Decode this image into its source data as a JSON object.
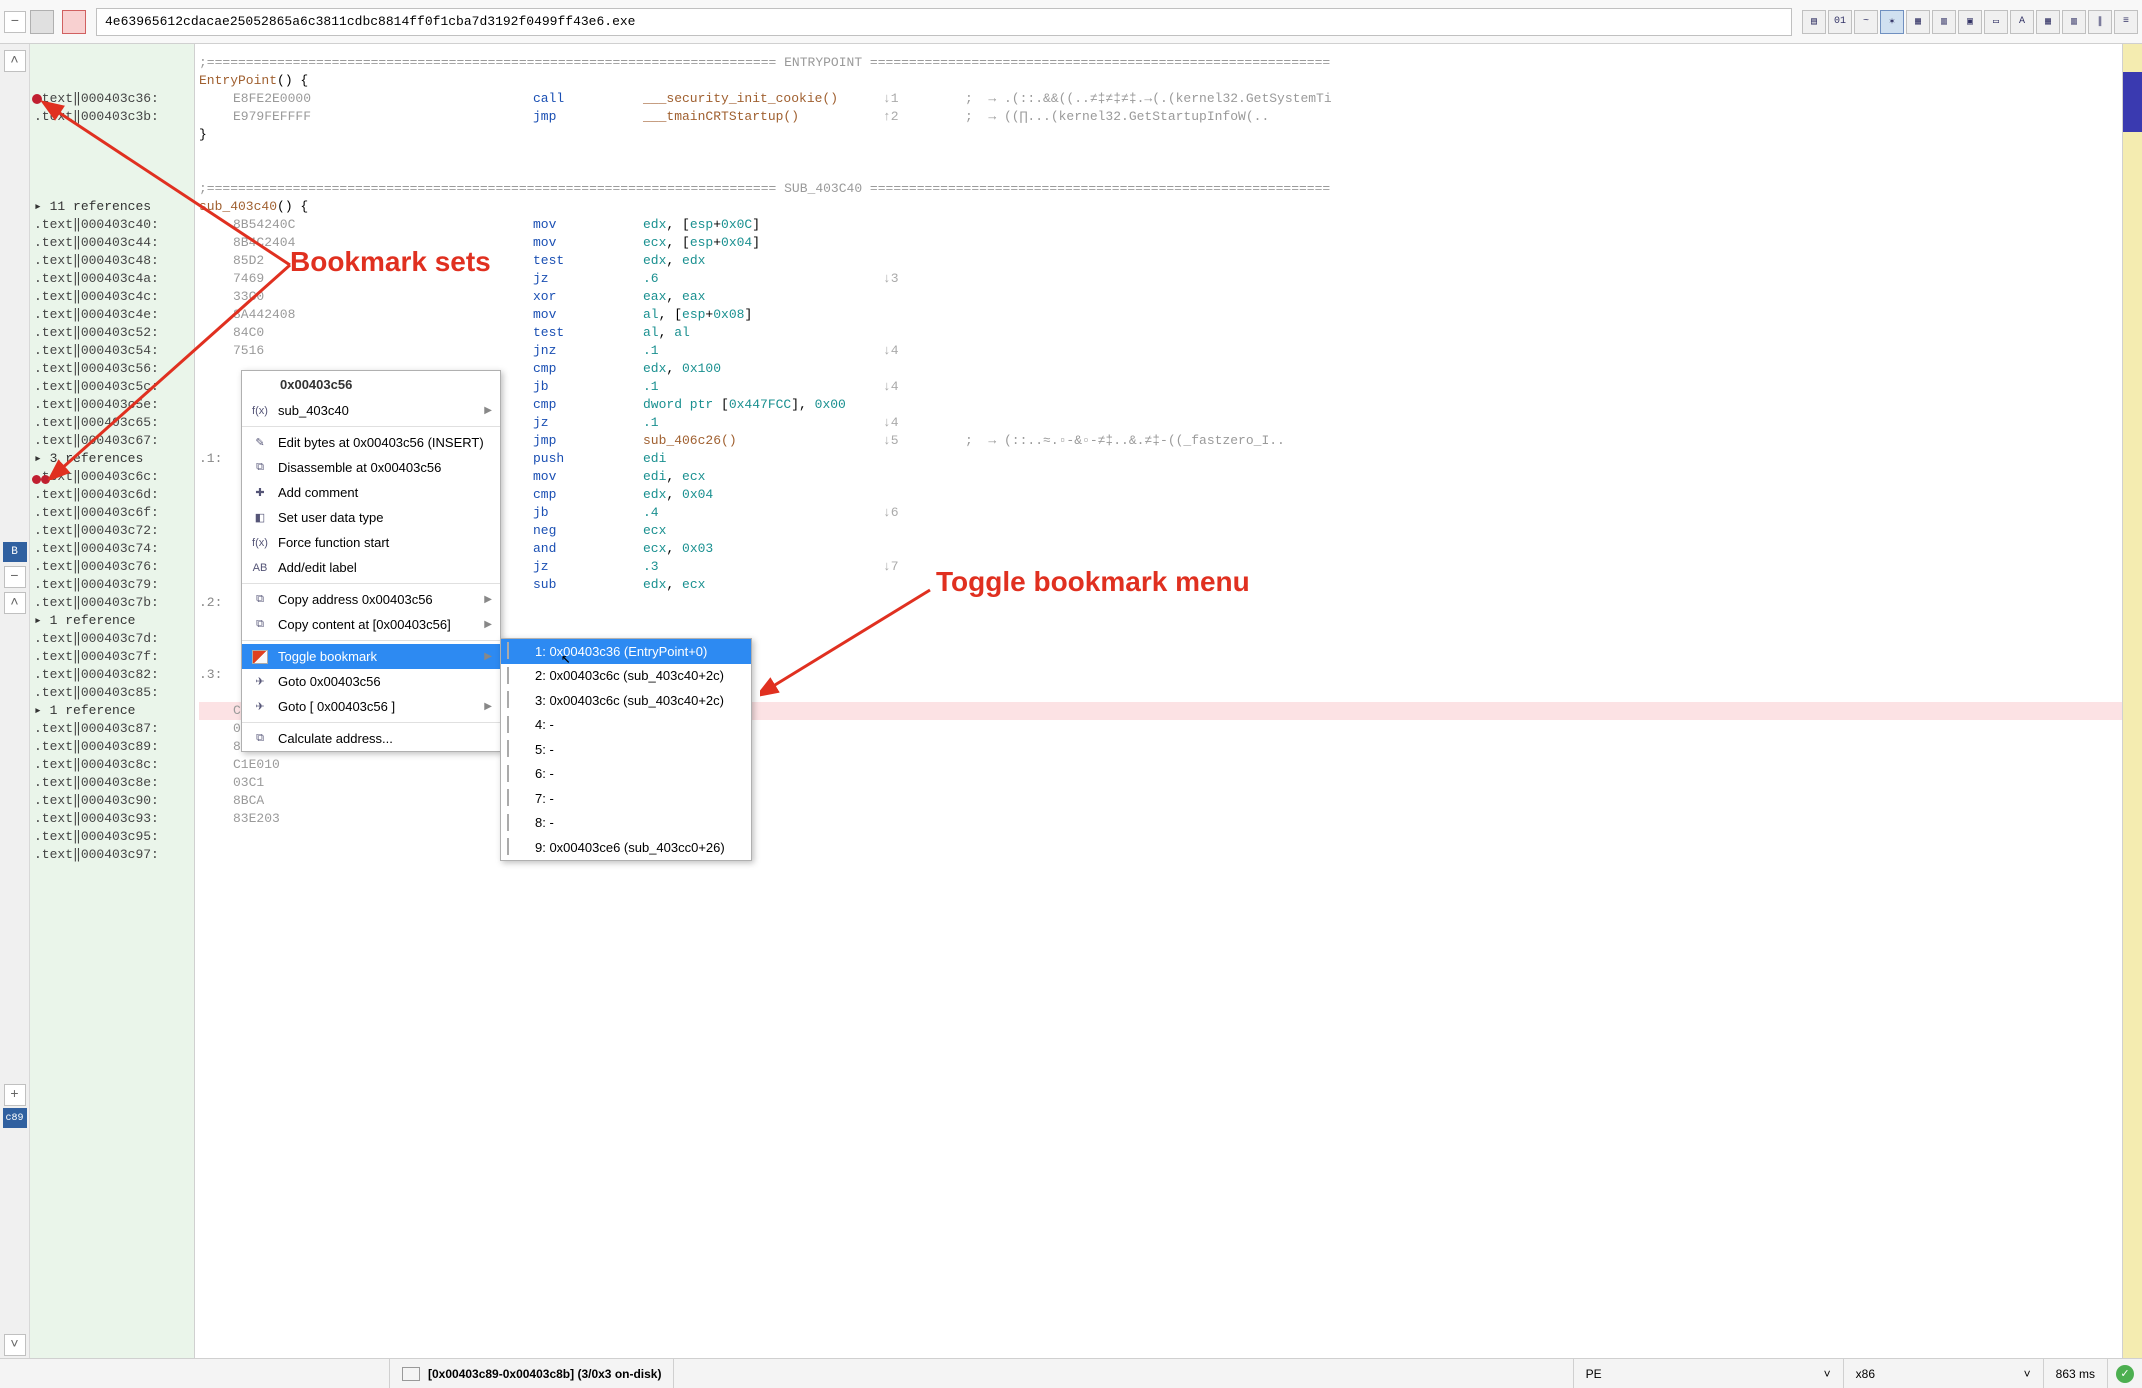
{
  "topbar": {
    "filename": "4e63965612cdacae25052865a6c3811cdbc8814ff0f1cba7d3192f0499ff43e6.exe"
  },
  "annotations": {
    "a1": "Bookmark sets",
    "a2": "Toggle bookmark menu"
  },
  "addr_lines": [
    {
      "t": ""
    },
    {
      "t": ""
    },
    {
      "t": "   .text‖000403c36:",
      "bk": 1
    },
    {
      "t": "   .text‖000403c3b:"
    },
    {
      "t": ""
    },
    {
      "t": ""
    },
    {
      "t": ""
    },
    {
      "t": ""
    },
    {
      "t": " ▸ 11 references",
      "ref": 1
    },
    {
      "t": "   .text‖000403c40:"
    },
    {
      "t": "   .text‖000403c44:"
    },
    {
      "t": "   .text‖000403c48:"
    },
    {
      "t": "   .text‖000403c4a:"
    },
    {
      "t": "   .text‖000403c4c:"
    },
    {
      "t": "   .text‖000403c4e:"
    },
    {
      "t": "   .text‖000403c52:"
    },
    {
      "t": "   .text‖000403c54:"
    },
    {
      "t": "   .text‖000403c56:"
    },
    {
      "t": "   .text‖000403c5c:"
    },
    {
      "t": "   .text‖000403c5e:"
    },
    {
      "t": "   .text‖000403c65:"
    },
    {
      "t": "   .text‖000403c67:"
    },
    {
      "t": " ▸ 3 references",
      "ref": 1
    },
    {
      "t": "   .text‖000403c6c:",
      "bk": 2
    },
    {
      "t": "   .text‖000403c6d:"
    },
    {
      "t": "   .text‖000403c6f:"
    },
    {
      "t": "   .text‖000403c72:"
    },
    {
      "t": "   .text‖000403c74:"
    },
    {
      "t": "   .text‖000403c76:"
    },
    {
      "t": "   .text‖000403c79:"
    },
    {
      "t": "   .text‖000403c7b:"
    },
    {
      "t": " ▸ 1 reference",
      "ref": 1
    },
    {
      "t": "   .text‖000403c7d:"
    },
    {
      "t": "   .text‖000403c7f:"
    },
    {
      "t": "   .text‖000403c82:"
    },
    {
      "t": "   .text‖000403c85:"
    },
    {
      "t": " ▸ 1 reference",
      "ref": 1
    },
    {
      "t": "   .text‖000403c87:"
    },
    {
      "t": "   .text‖000403c89:"
    },
    {
      "t": "   .text‖000403c8c:"
    },
    {
      "t": "   .text‖000403c8e:"
    },
    {
      "t": "   .text‖000403c90:"
    },
    {
      "t": "   .text‖000403c93:"
    },
    {
      "t": "   .text‖000403c95:"
    },
    {
      "t": "   .text‖000403c97:"
    }
  ],
  "code": {
    "sep1_l": ";========================================================================= ",
    "sep1_m": "ENTRYPOINT",
    "sep1_r": " ===========================================================",
    "entry_sig": "EntryPoint() {",
    "r1_hex": "E8FE2E0000",
    "r1_mn": "call",
    "r1_fn": "___security_init_cookie()",
    "r1_j": "↓1",
    "r1_c": ";  → .(::.&&((..≠‡≠‡≠‡.→(.(kernel32.GetSystemTi",
    "r2_hex": "E979FEFFFF",
    "r2_mn": "jmp",
    "r2_fn": "___tmainCRTStartup()",
    "r2_j": "↑2",
    "r2_c": ";  → ((∏...(kernel32.GetStartupInfoW(..",
    "close": "}",
    "sep2_l": ";========================================================================= ",
    "sep2_m": "SUB_403C40",
    "sep2_r": " ===========================================================",
    "sub_sig": "sub_403c40() {",
    "rows": [
      {
        "h": "8B54240C",
        "m": "mov",
        "o": "edx, [esp+0x0C]"
      },
      {
        "l": "",
        "h": "8B4C2404",
        "m": "mov",
        "o": "ecx, [esp+0x04]"
      },
      {
        "l": "",
        "h": "85D2",
        "m": "test",
        "o": "edx, edx"
      },
      {
        "l": "",
        "h": "7469",
        "m": "jz",
        "o": ".6",
        "j": "↓3"
      },
      {
        "l": "",
        "h": "33C0",
        "m": "xor",
        "o": "eax, eax"
      },
      {
        "l": "",
        "h": "8A442408",
        "m": "mov",
        "o": "al, [esp+0x08]"
      },
      {
        "l": "",
        "h": "84C0",
        "m": "test",
        "o": "al, al"
      },
      {
        "l": "",
        "h": "7516",
        "m": "jnz",
        "o": ".1",
        "j": "↓4"
      },
      {
        "l": "",
        "h": "",
        "m": "cmp",
        "o": "edx, 0x100"
      },
      {
        "l": "",
        "h": "",
        "m": "jb",
        "o": ".1",
        "j": "↓4"
      },
      {
        "l": "",
        "h": "",
        "m": "cmp",
        "o": "dword ptr [0x447FCC], 0x00"
      },
      {
        "l": "",
        "h": "",
        "m": "jz",
        "o": ".1",
        "j": "↓4"
      },
      {
        "l": "",
        "h": "",
        "m": "jmp",
        "o": "sub_406c26()",
        "j": "↓5",
        "c": ";  → (::..≈.▫-&▫-≠‡..&.≠‡-((_fastzero_I.."
      },
      {
        "l": ".1:",
        "h": "",
        "m": "push",
        "o": "edi"
      },
      {
        "l": "",
        "h": "",
        "m": "mov",
        "o": "edi, ecx"
      },
      {
        "l": "",
        "h": "",
        "m": "cmp",
        "o": "edx, 0x04"
      },
      {
        "l": "",
        "h": "",
        "m": "jb",
        "o": ".4",
        "j": "↓6"
      },
      {
        "l": "",
        "h": "",
        "m": "neg",
        "o": "ecx"
      },
      {
        "l": "",
        "h": "",
        "m": "and",
        "o": "ecx, 0x03"
      },
      {
        "l": "",
        "h": "",
        "m": "jz",
        "o": ".3",
        "j": "↓7"
      },
      {
        "l": "",
        "h": "",
        "m": "sub",
        "o": "edx, ecx"
      },
      {
        "l": ".2:",
        "h": "",
        "m": "",
        "o": ""
      },
      {
        "l": "",
        "h": "",
        "m": "",
        "o": ""
      },
      {
        "l": "",
        "h": "",
        "m": "",
        "o": ""
      },
      {
        "l": "",
        "h": "",
        "m": "",
        "o": ""
      },
      {
        "l": ".3:",
        "h": "",
        "m": "",
        "o": ""
      },
      {
        "l": "",
        "h": "",
        "m": "",
        "o": ""
      },
      {
        "l": "",
        "h": "C1E008",
        "m": "",
        "o": "",
        "hl": 1
      },
      {
        "l": "",
        "h": "03C1",
        "m": "",
        "o": ""
      },
      {
        "l": "",
        "h": "8BC8",
        "m": "",
        "o": ""
      },
      {
        "l": "",
        "h": "C1E010",
        "m": "",
        "o": ""
      },
      {
        "l": "",
        "h": "03C1",
        "m": "",
        "o": ""
      },
      {
        "l": "",
        "h": "8BCA",
        "m": "",
        "o": ""
      },
      {
        "l": "",
        "h": "83E203",
        "m": "",
        "o": ""
      }
    ]
  },
  "ctx": {
    "title": "0x00403c56",
    "items": [
      {
        "ico": "f(x)",
        "t": "sub_403c40",
        "sub": 1
      },
      {
        "ico": "✎",
        "t": "Edit bytes at 0x00403c56 (INSERT)"
      },
      {
        "ico": "⧉",
        "t": "Disassemble at 0x00403c56"
      },
      {
        "ico": "✚",
        "t": "Add comment"
      },
      {
        "ico": "◧",
        "t": "Set user data type"
      },
      {
        "ico": "f(x)",
        "t": "Force function start"
      },
      {
        "ico": "AB",
        "t": "Add/edit label"
      },
      {
        "ico": "⧉",
        "t": "Copy address 0x00403c56",
        "sub": 1
      },
      {
        "ico": "⧉",
        "t": "Copy content at [0x00403c56]",
        "sub": 1
      },
      {
        "ico": "bm",
        "t": "Toggle bookmark",
        "sub": 1,
        "hl": 1
      },
      {
        "ico": "✈",
        "t": "Goto 0x00403c56"
      },
      {
        "ico": "✈",
        "t": "Goto [ 0x00403c56 ]",
        "sub": 1
      },
      {
        "ico": "⧉",
        "t": "Calculate address..."
      }
    ]
  },
  "submenu": [
    {
      "t": "1: 0x00403c36 (EntryPoint+0)",
      "hl": 1
    },
    {
      "t": "2: 0x00403c6c (sub_403c40+2c)"
    },
    {
      "t": "3: 0x00403c6c (sub_403c40+2c)"
    },
    {
      "t": "4: -"
    },
    {
      "t": "5: -"
    },
    {
      "t": "6: -"
    },
    {
      "t": "7: -"
    },
    {
      "t": "8: -"
    },
    {
      "t": "9: 0x00403ce6 (sub_403cc0+26)"
    }
  ],
  "status": {
    "sel": "[0x00403c89-0x00403c8b] (3/0x3 on-disk)",
    "fmt": "PE",
    "arch": "x86",
    "time": "863 ms"
  },
  "tagB": "B",
  "tagC": "c89"
}
